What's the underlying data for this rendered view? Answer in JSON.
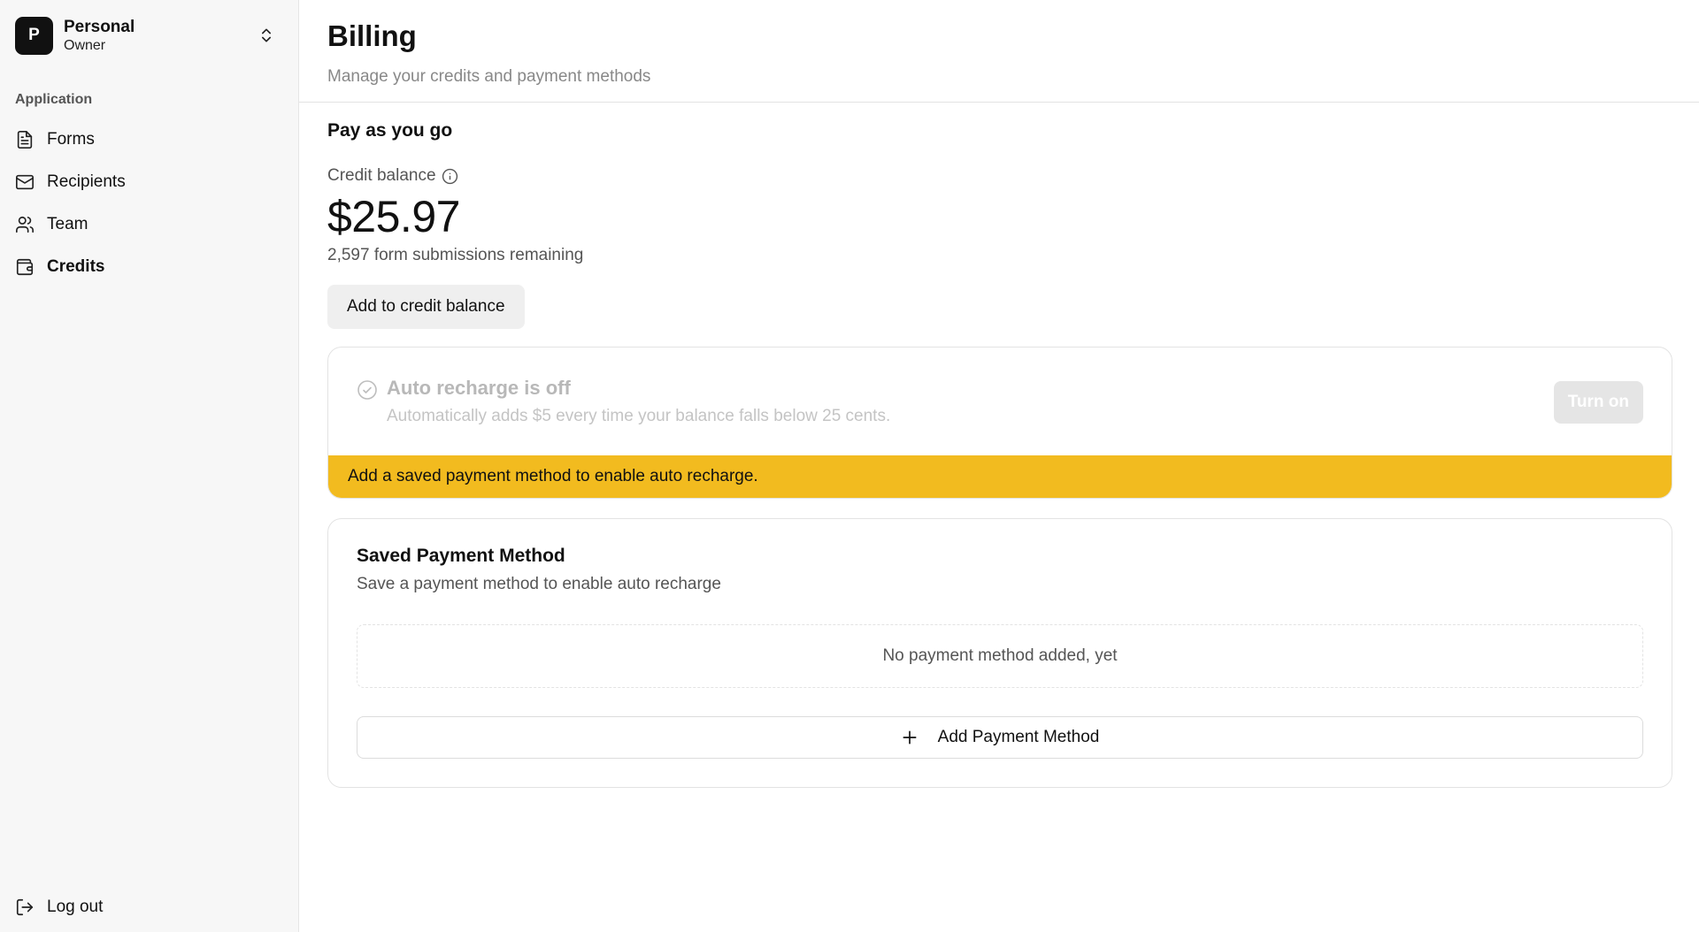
{
  "workspace": {
    "avatar_letter": "P",
    "name": "Personal",
    "role": "Owner",
    "switch_icon": "chevrons-up-down-icon"
  },
  "sidebar": {
    "section_label": "Application",
    "items": [
      {
        "label": "Forms",
        "icon": "file-text-icon",
        "active": false
      },
      {
        "label": "Recipients",
        "icon": "mail-icon",
        "active": false
      },
      {
        "label": "Team",
        "icon": "users-icon",
        "active": false
      },
      {
        "label": "Credits",
        "icon": "wallet-icon",
        "active": true
      }
    ],
    "logout_label": "Log out"
  },
  "header": {
    "title": "Billing",
    "subtitle": "Manage your credits and payment methods"
  },
  "billing": {
    "section_title": "Pay as you go",
    "balance_label": "Credit balance",
    "balance_amount": "$25.97",
    "remaining": "2,597 form submissions remaining",
    "add_credit_label": "Add to credit balance"
  },
  "auto_recharge": {
    "title": "Auto recharge is off",
    "description": "Automatically adds $5 every time your balance falls below 25 cents.",
    "turn_on_label": "Turn on",
    "warning": "Add a saved payment method to enable auto recharge.",
    "warning_color": "#f2bb1f"
  },
  "payment_method": {
    "title": "Saved Payment Method",
    "subtitle": "Save a payment method to enable auto recharge",
    "empty_text": "No payment method added, yet",
    "add_label": "Add Payment Method"
  }
}
